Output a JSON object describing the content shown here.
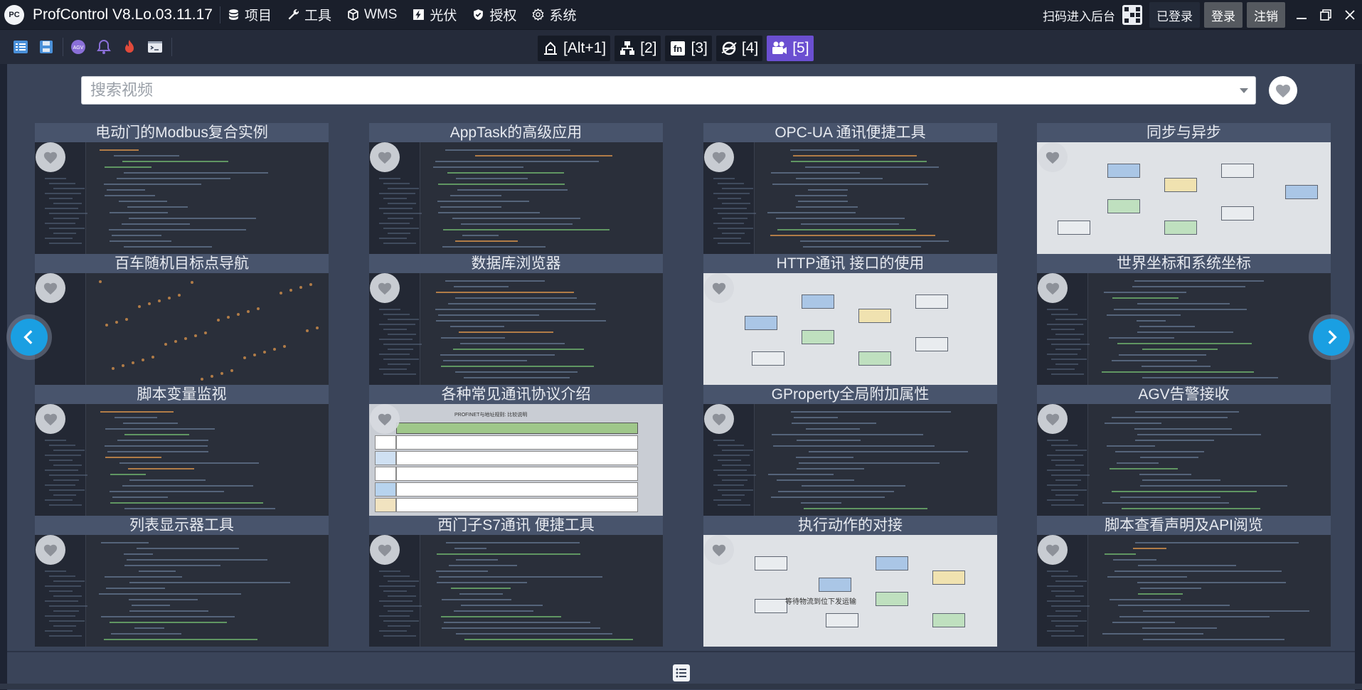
{
  "titlebar": {
    "logo_text": "PC",
    "app_title": "ProfControl V8.Lo.03.11.17",
    "menu": [
      {
        "label": "项目",
        "icon": "database-icon"
      },
      {
        "label": "工具",
        "icon": "wrench-icon"
      },
      {
        "label": "WMS",
        "icon": "cube-icon"
      },
      {
        "label": "光伏",
        "icon": "bolt-icon"
      },
      {
        "label": "授权",
        "icon": "shield-check-icon"
      },
      {
        "label": "系统",
        "icon": "gear-icon"
      }
    ],
    "scan_label": "扫码进入后台",
    "logged_in_label": "已登录",
    "login_label": "登录",
    "logout_label": "注销"
  },
  "toolbar": {
    "icons": [
      "list-view-icon",
      "save-icon",
      "agv-icon",
      "bell-icon",
      "fire-icon",
      "terminal-icon"
    ],
    "tabs": [
      {
        "label": "[Alt+1]",
        "icon": "crane-icon",
        "active": false
      },
      {
        "label": "[2]",
        "icon": "network-icon",
        "active": false
      },
      {
        "label": "[3]",
        "icon": "fn-icon",
        "active": false
      },
      {
        "label": "[4]",
        "icon": "browser-icon",
        "active": false
      },
      {
        "label": "[5]",
        "icon": "video-camera-icon",
        "active": true
      }
    ]
  },
  "search": {
    "placeholder": "搜索视频",
    "value": ""
  },
  "videos": [
    {
      "title": "电动门的Modbus复合实例",
      "thumb": "code"
    },
    {
      "title": "AppTask的高级应用",
      "thumb": "code"
    },
    {
      "title": "OPC-UA 通讯便捷工具",
      "thumb": "code"
    },
    {
      "title": "同步与异步",
      "thumb": "diagram"
    },
    {
      "title": "百车随机目标点导航",
      "thumb": "map"
    },
    {
      "title": "数据库浏览器",
      "thumb": "code"
    },
    {
      "title": "HTTP通讯 接口的使用",
      "thumb": "diagram"
    },
    {
      "title": "世界坐标和系统坐标",
      "thumb": "code"
    },
    {
      "title": "脚本变量监视",
      "thumb": "code"
    },
    {
      "title": "各种常见通讯协议介绍",
      "thumb": "table"
    },
    {
      "title": "GProperty全局附加属性",
      "thumb": "code"
    },
    {
      "title": "AGV告警接收",
      "thumb": "code"
    },
    {
      "title": "列表显示器工具",
      "thumb": "code"
    },
    {
      "title": "西门子S7通讯 便捷工具",
      "thumb": "code"
    },
    {
      "title": "执行动作的对接",
      "thumb": "diagram"
    },
    {
      "title": "脚本查看声明及API阅览",
      "thumb": "code"
    }
  ],
  "thumb_texts": {
    "table_header": "PROFINET与地址规则: 比较说明",
    "diagram_caption": "等待物流到位下发运输"
  },
  "colors": {
    "active_tab": "#6b4fd1",
    "nav_arrow": "#1a9fe2",
    "panel_bg": "#3a4459"
  }
}
